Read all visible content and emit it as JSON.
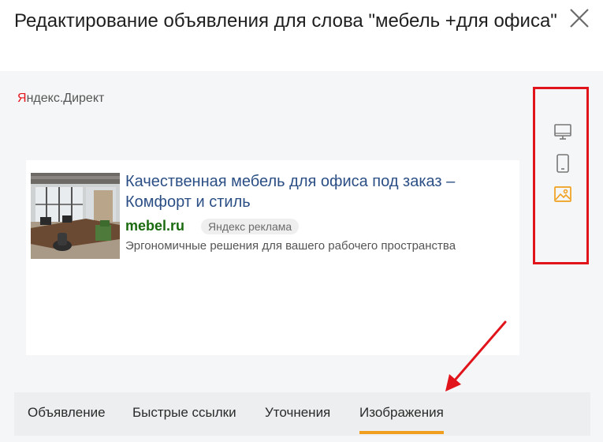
{
  "modal": {
    "title": "Редактирование объявления для слова \"мебель +для офиса\"",
    "close_icon": "close-icon"
  },
  "preview": {
    "brand_prefix": "Я",
    "brand_rest": "ндекс.Директ",
    "ad": {
      "title": "Качественная мебель для офиса под заказ – Комфорт и стиль",
      "domain": "mebel.ru",
      "badge": "Яндекс реклама",
      "description": "Эргономичные решения для вашего рабочего пространства"
    },
    "devices": [
      {
        "icon": "desktop-icon",
        "active": false
      },
      {
        "icon": "mobile-icon",
        "active": false
      },
      {
        "icon": "image-icon",
        "active": true
      }
    ]
  },
  "tabs": [
    {
      "label": "Объявление",
      "active": false
    },
    {
      "label": "Быстрые ссылки",
      "active": false
    },
    {
      "label": "Уточнения",
      "active": false
    },
    {
      "label": "Изображения",
      "active": true
    }
  ],
  "colors": {
    "accent": "#f0a01e",
    "annotation": "#e0141a",
    "link": "#2b4f85",
    "domain": "#1a6b0f"
  }
}
